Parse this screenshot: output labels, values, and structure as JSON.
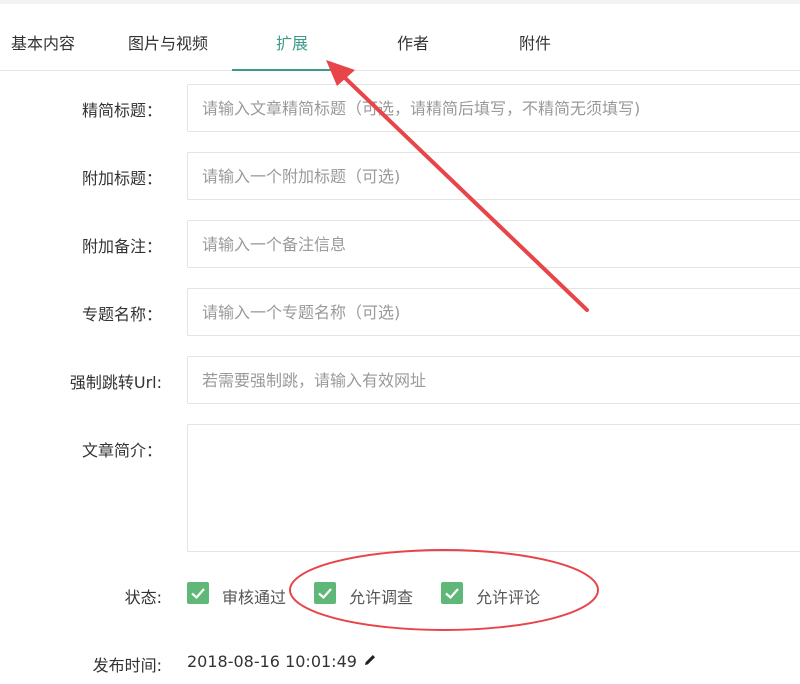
{
  "tabs": [
    {
      "label": "基本内容"
    },
    {
      "label": "图片与视频"
    },
    {
      "label": "扩展",
      "active": true
    },
    {
      "label": "作者"
    },
    {
      "label": "附件"
    }
  ],
  "form": {
    "short_title": {
      "label": "精简标题：",
      "placeholder": "请输入文章精简标题（可选，请精简后填写，不精简无须填写)"
    },
    "sub_title": {
      "label": "附加标题：",
      "placeholder": "请输入一个附加标题（可选)"
    },
    "note": {
      "label": "附加备注：",
      "placeholder": "请输入一个备注信息"
    },
    "topic": {
      "label": "专题名称：",
      "placeholder": "请输入一个专题名称（可选)"
    },
    "redirect_url": {
      "label": "强制跳转Url:",
      "placeholder": "若需要强制跳，请输入有效网址"
    },
    "summary": {
      "label": "文章简介：",
      "placeholder": ""
    },
    "status": {
      "label": "状态:",
      "options": [
        {
          "label": "审核通过",
          "checked": true
        },
        {
          "label": "允许调查",
          "checked": true
        },
        {
          "label": "允许评论",
          "checked": true
        }
      ]
    },
    "publish_time": {
      "label": "发布时间:",
      "value": "2018-08-16 10:01:49"
    }
  },
  "colors": {
    "accent": "#3d9a8a",
    "checkbox": "#5fb878",
    "annotation": "#e8454a"
  },
  "icons": {
    "edit": "pencil-icon",
    "check": "check-icon"
  }
}
